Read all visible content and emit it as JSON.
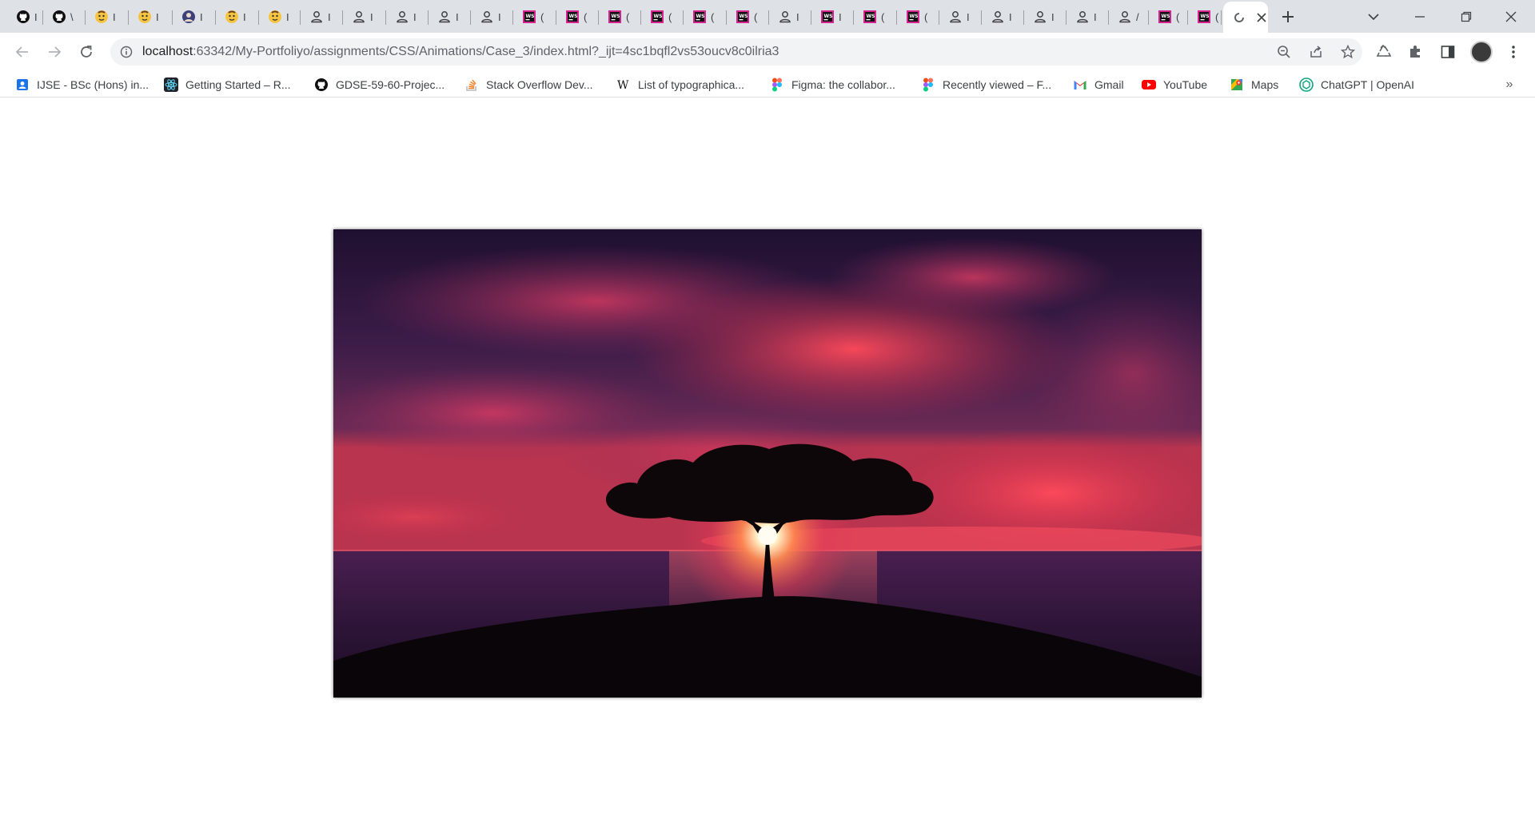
{
  "window": {
    "tabs": [
      {
        "icon": "github-icon",
        "char": "I"
      },
      {
        "icon": "github-icon",
        "char": "\\"
      },
      {
        "icon": "avatar-emoji-icon",
        "char": "I"
      },
      {
        "icon": "avatar-emoji-icon",
        "char": "I"
      },
      {
        "icon": "profile-photo-icon",
        "char": "I"
      },
      {
        "icon": "avatar-emoji-icon",
        "char": "I"
      },
      {
        "icon": "avatar-emoji-icon",
        "char": "I"
      },
      {
        "icon": "user-icon",
        "char": "I"
      },
      {
        "icon": "user-icon",
        "char": "I"
      },
      {
        "icon": "user-icon",
        "char": "I"
      },
      {
        "icon": "user-icon",
        "char": "I"
      },
      {
        "icon": "user-icon",
        "char": "I"
      },
      {
        "icon": "jetbrains-icon",
        "char": "("
      },
      {
        "icon": "jetbrains-icon",
        "char": "("
      },
      {
        "icon": "jetbrains-icon",
        "char": "("
      },
      {
        "icon": "jetbrains-icon",
        "char": "("
      },
      {
        "icon": "jetbrains-icon",
        "char": "("
      },
      {
        "icon": "jetbrains-icon",
        "char": "("
      },
      {
        "icon": "user-icon",
        "char": "I"
      },
      {
        "icon": "jetbrains-icon",
        "char": "I"
      },
      {
        "icon": "jetbrains-icon",
        "char": "("
      },
      {
        "icon": "jetbrains-icon",
        "char": "("
      },
      {
        "icon": "user-icon",
        "char": "I"
      },
      {
        "icon": "user-icon",
        "char": "I"
      },
      {
        "icon": "user-icon",
        "char": "I"
      },
      {
        "icon": "user-icon",
        "char": "I"
      },
      {
        "icon": "user-icon",
        "char": "/"
      },
      {
        "icon": "jetbrains-icon",
        "char": "("
      },
      {
        "icon": "jetbrains-icon",
        "char": "("
      }
    ],
    "active_tab": {
      "icon": "loading-icon",
      "char": ""
    }
  },
  "toolbar": {
    "url_host": "localhost",
    "url_rest": ":63342/My-Portfoliyo/assignments/CSS/Animations/Case_3/index.html?_ijt=4sc1bqfl2vs53oucv8c0ilria3"
  },
  "bookmarks": [
    {
      "icon": "contacts-icon",
      "label": "IJSE - BSc (Hons) in...",
      "color": "#1a73e8"
    },
    {
      "icon": "react-icon",
      "label": "Getting Started – R...",
      "color": "#20232a"
    },
    {
      "icon": "github-icon",
      "label": "GDSE-59-60-Projec...",
      "color": "#111111"
    },
    {
      "icon": "stackoverflow-icon",
      "label": "Stack Overflow Dev...",
      "color": "#f48024"
    },
    {
      "icon": "wikipedia-icon",
      "label": "List of typographica...",
      "color": "#111111"
    },
    {
      "icon": "figma-icon",
      "label": "Figma: the collabor...",
      "color": "#a259ff"
    },
    {
      "icon": "figma-icon",
      "label": "Recently viewed – F...",
      "color": "#a259ff"
    },
    {
      "icon": "gmail-icon",
      "label": "Gmail",
      "color": "#ea4335"
    },
    {
      "icon": "youtube-icon",
      "label": "YouTube",
      "color": "#ff0000"
    },
    {
      "icon": "maps-icon",
      "label": "Maps",
      "color": "#34a853"
    },
    {
      "icon": "chatgpt-icon",
      "label": "ChatGPT | OpenAI",
      "color": "#10a37f"
    }
  ],
  "bookmarks_more": "»",
  "content": {
    "image_alt": "tree-at-sunset-image",
    "colors": {
      "sky_top": "#2a1540",
      "sky_mid": "#6a2a55",
      "cloud": "#e0405a",
      "sun": "#fff6d0",
      "sea": "#3a1b45",
      "ground": "#0a0508"
    }
  }
}
